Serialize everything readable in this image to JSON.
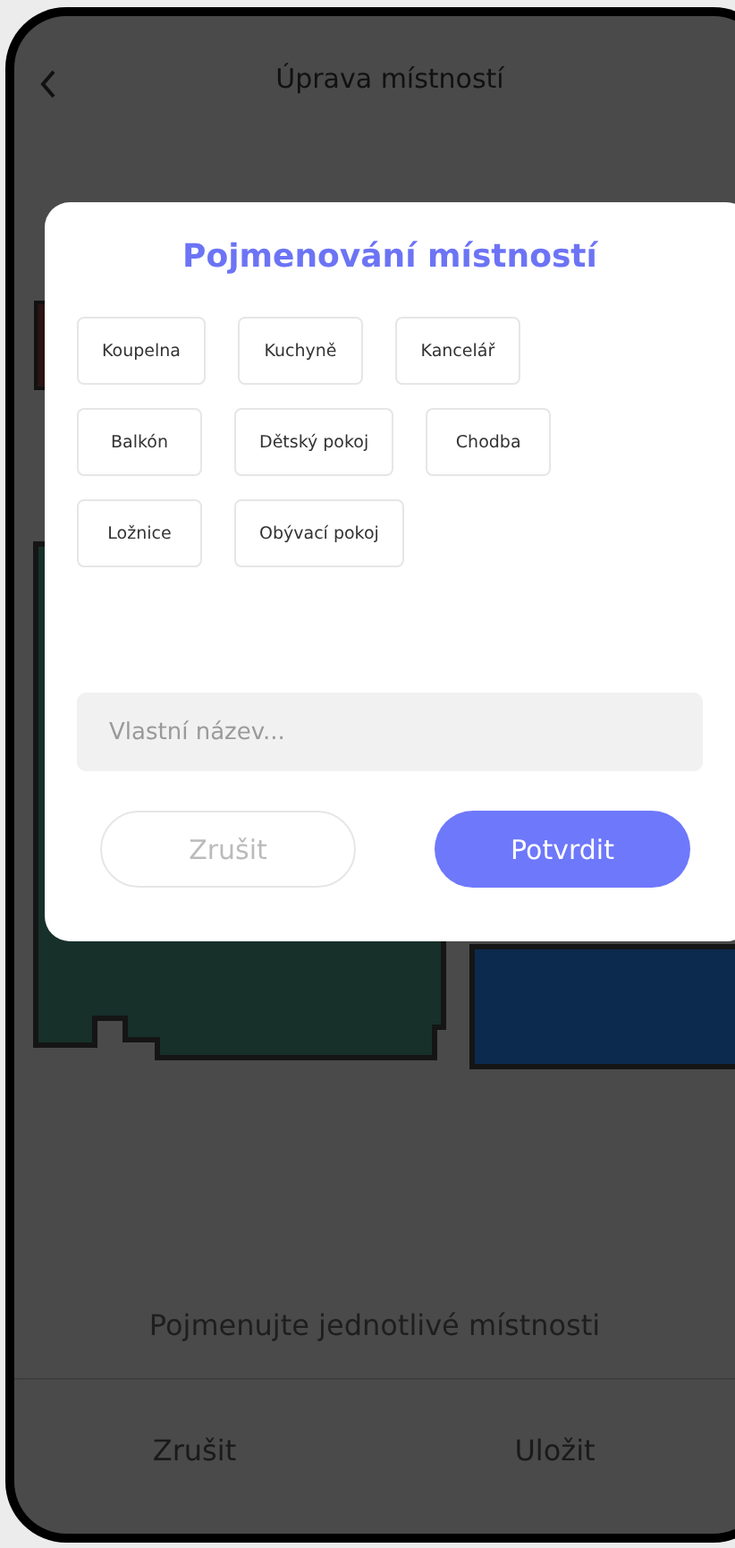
{
  "header": {
    "title": "Úprava místností"
  },
  "dialog": {
    "title": "Pojmenování místností",
    "suggestions": [
      [
        "Koupelna",
        "Kuchyně",
        "Kancelář"
      ],
      [
        "Balkón",
        "Dětský pokoj",
        "Chodba"
      ],
      [
        "Ložnice",
        "Obývací pokoj"
      ]
    ],
    "custom_name": {
      "placeholder": "Vlastní název..."
    },
    "buttons": [
      {
        "label": "Zrušit",
        "kind": "secondary"
      },
      {
        "label": "Potvrdit",
        "kind": "primary"
      }
    ]
  },
  "hint": "Pojmenujte jednotlivé místnosti",
  "bottom_bar": [
    "Zrušit",
    "Uložit"
  ]
}
